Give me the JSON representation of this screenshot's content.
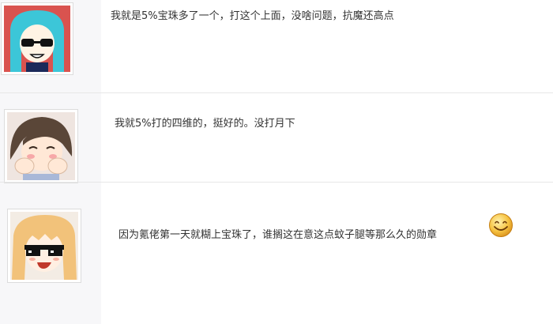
{
  "posts": [
    {
      "avatar": "cyan-hair-sunglasses-avatar",
      "text": "我就是5%宝珠多了一个，打这个上面，没啥问题，抗魔还高点"
    },
    {
      "avatar": "brown-hair-laughing-avatar",
      "text": "我就5%打的四维的，挺好的。没打月下"
    },
    {
      "avatar": "blonde-hair-pixel-glasses-avatar",
      "text": "因为氪佬第一天就糊上宝珠了，谁搁这在意这点蚊子腿等那么久的勋章",
      "emoji": "smile-emoji-icon"
    }
  ],
  "colors": {
    "divider": "#e7e7e7",
    "sidebar": "#f7f7f9",
    "text": "#333333"
  }
}
